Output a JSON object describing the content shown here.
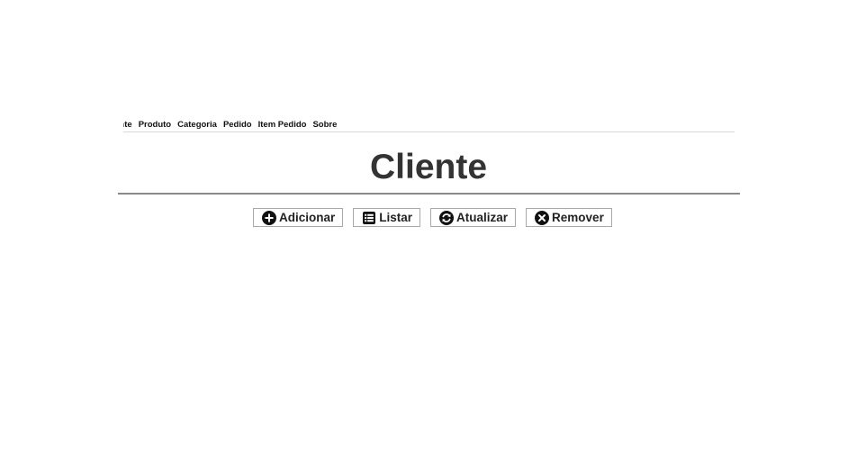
{
  "nav": {
    "items": [
      "Cliente",
      "Produto",
      "Categoria",
      "Pedido",
      "Item Pedido",
      "Sobre"
    ]
  },
  "page": {
    "title": "Cliente"
  },
  "toolbar": {
    "add_label": "Adicionar",
    "list_label": "Listar",
    "update_label": "Atualizar",
    "remove_label": "Remover"
  },
  "icons": {
    "add": "plus-circle-icon",
    "list": "list-icon",
    "update": "refresh-icon",
    "remove": "close-circle-icon"
  }
}
